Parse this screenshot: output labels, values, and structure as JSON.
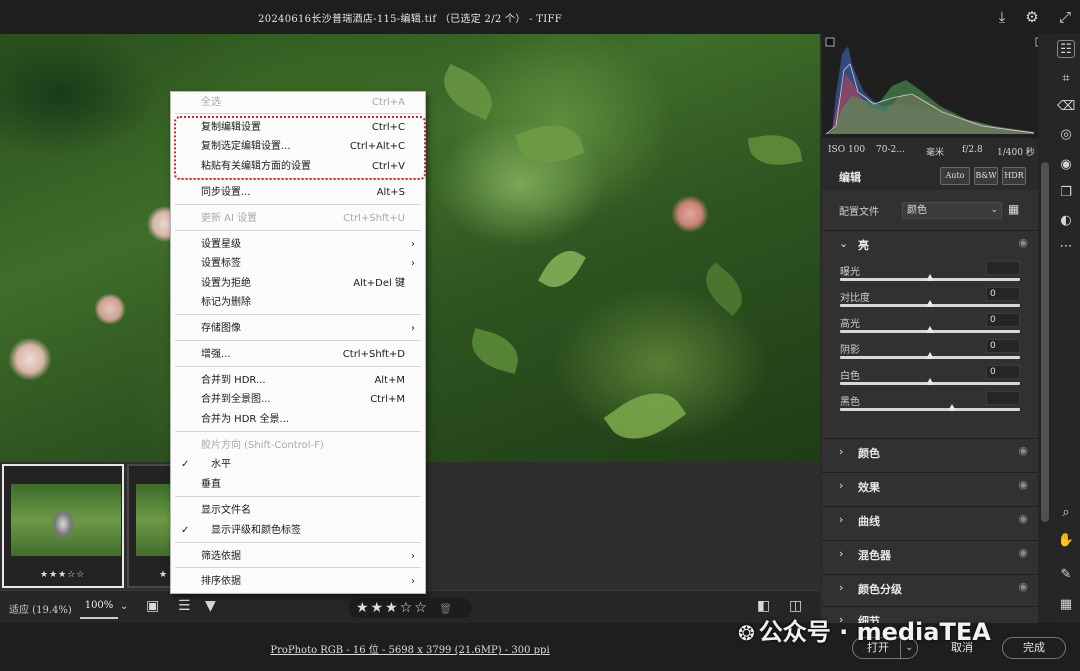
{
  "window": {
    "title": "20240616长沙普瑞酒店-115-编辑.tif （已选定 2/2 个） - TIFF"
  },
  "context_menu": {
    "items": [
      {
        "label": "全选",
        "shortcut": "Ctrl+A",
        "disabled": true
      },
      {
        "label": "复制编辑设置",
        "shortcut": "Ctrl+C"
      },
      {
        "label": "复制选定编辑设置...",
        "shortcut": "Ctrl+Alt+C"
      },
      {
        "label": "粘贴有关编辑方面的设置",
        "shortcut": "Ctrl+V"
      },
      {
        "label": "同步设置...",
        "shortcut": "Alt+S"
      },
      {
        "label": "更新 AI 设置",
        "shortcut": "Ctrl+Shft+U",
        "disabled": true
      },
      {
        "label": "设置星级",
        "submenu": true
      },
      {
        "label": "设置标签",
        "submenu": true
      },
      {
        "label": "设置为拒绝",
        "shortcut": "Alt+Del 键"
      },
      {
        "label": "标记为删除"
      },
      {
        "label": "存储图像",
        "submenu": true
      },
      {
        "label": "增强...",
        "shortcut": "Ctrl+Shft+D"
      },
      {
        "label": "合并到 HDR...",
        "shortcut": "Alt+M"
      },
      {
        "label": "合并到全景图...",
        "shortcut": "Ctrl+M"
      },
      {
        "label": "合并为 HDR 全景..."
      },
      {
        "label": "胶片方向 (Shift-Control-F)",
        "disabled": true
      },
      {
        "label": "水平",
        "checked": true
      },
      {
        "label": "垂直"
      },
      {
        "label": "显示文件名"
      },
      {
        "label": "显示评级和颜色标签",
        "checked": true
      },
      {
        "label": "筛选依据",
        "submenu": true
      },
      {
        "label": "排序依据",
        "submenu": true
      }
    ],
    "submenu_arrow": "›",
    "check_mark": "✓"
  },
  "filmstrip": {
    "thumb1_stars": "★★★☆☆",
    "thumb2_stars": "★"
  },
  "bottom_bar": {
    "fit_label": "适应 (19.4%)",
    "zoom_value": "100%",
    "rating_stars": "★★★☆☆",
    "delete_icon": "🗑"
  },
  "status_bar": {
    "profile_link": "ProPhoto RGB - 16 位 - 5698 x 3799 (21.6MP) - 300 ppi",
    "open_button": "打开",
    "cancel_button": "取消",
    "done_button": "完成"
  },
  "watermark": {
    "text": "公众号 · mediaTEA"
  },
  "panel": {
    "exif": {
      "iso": "ISO 100",
      "focal": "70-2...",
      "unit": "毫米",
      "aperture": "f/2.8",
      "shutter": "1/400 秒"
    },
    "edit_title": "编辑",
    "auto_button": "Auto",
    "bw_button": "B&W",
    "hdr_button": "HDR",
    "profile_label": "配置文件",
    "profile_value": "颜色",
    "light_section": "亮",
    "sliders": [
      {
        "label": "曝光",
        "value": "",
        "level": 0.5
      },
      {
        "label": "对比度",
        "value": "0",
        "level": 0.5
      },
      {
        "label": "高光",
        "value": "0",
        "level": 0.5
      },
      {
        "label": "阴影",
        "value": "0",
        "level": 0.5
      },
      {
        "label": "白色",
        "value": "0",
        "level": 0.5
      },
      {
        "label": "黑色",
        "value": "",
        "level": 0.62
      }
    ],
    "sections": [
      "颜色",
      "效果",
      "曲线",
      "混色器",
      "颜色分级"
    ],
    "partial_section": "细节"
  },
  "colors": {
    "menu_bg": "#fbfbfb",
    "highlight": "#d32424",
    "panel_bg": "#313131"
  },
  "icons": {
    "export": "⤓",
    "gear": "⚙",
    "expand": "⤢"
  }
}
